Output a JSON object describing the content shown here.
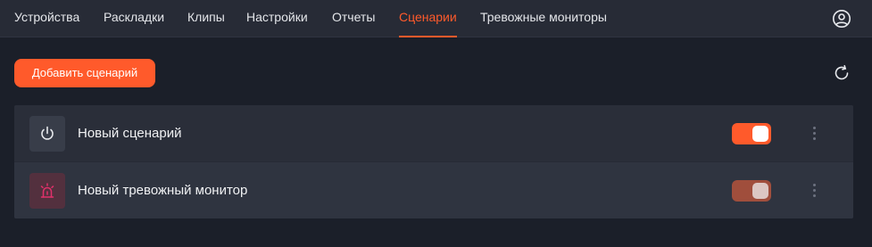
{
  "nav": {
    "tabs": [
      {
        "label": "Устройства"
      },
      {
        "label": "Раскладки"
      },
      {
        "label": "Клипы"
      },
      {
        "label": "Настройки"
      },
      {
        "label": "Отчеты"
      },
      {
        "label": "Сценарии",
        "active": true
      },
      {
        "label": "Тревожные мониторы"
      }
    ],
    "profile_icon": "user-circle-icon"
  },
  "toolbar": {
    "add_label": "Добавить сценарий",
    "refresh_icon": "refresh-icon"
  },
  "scenarios": [
    {
      "name": "Новый сценарий",
      "icon": "power-icon",
      "enabled": true,
      "toggle_color": "#ff5a2b"
    },
    {
      "name": "Новый тревожный монитор",
      "icon": "alarm-siren-icon",
      "enabled": true,
      "toggle_color": "#a04e3c"
    }
  ],
  "colors": {
    "accent": "#ff5a2b",
    "background": "#1b1f29",
    "nav_background": "#272b36",
    "alarm_icon": "#e0306a"
  }
}
